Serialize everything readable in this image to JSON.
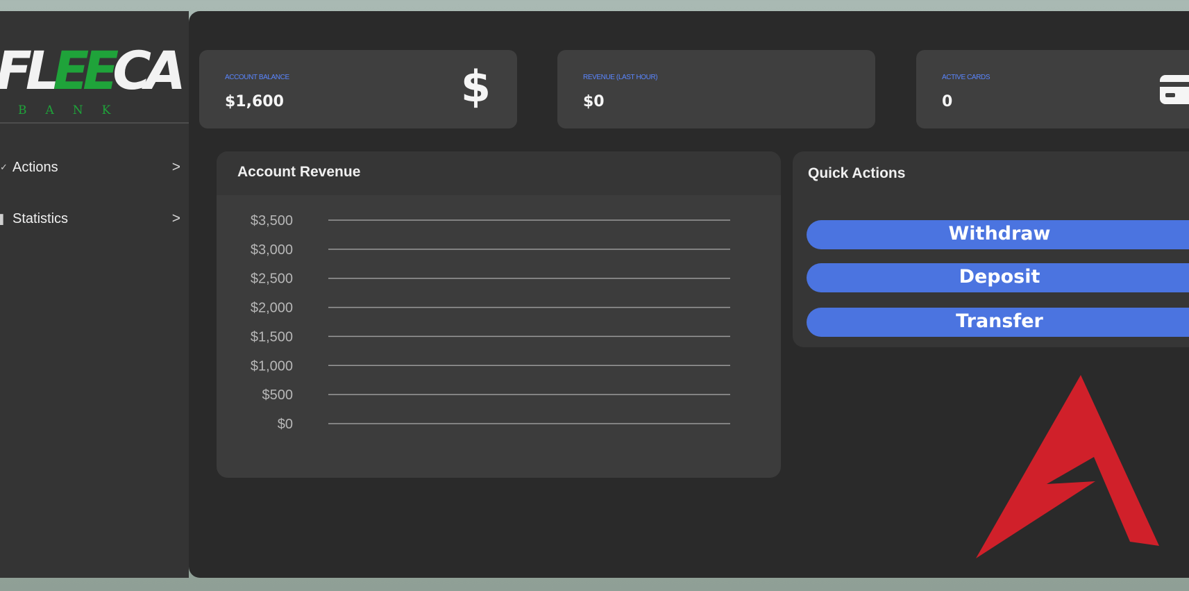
{
  "sidebar": {
    "logo_word_white_1": "FL",
    "logo_word_green": "EE",
    "logo_word_white_2": "CA",
    "logo_subtitle": "BANK",
    "items": [
      {
        "label": "Actions",
        "icon": "check-icon",
        "chevron": ">"
      },
      {
        "label": "Statistics",
        "icon": "bar-chart-icon",
        "chevron": ">"
      }
    ]
  },
  "stats": [
    {
      "label": "ACCOUNT BALANCE",
      "value": "$1,600",
      "icon": "dollar-icon",
      "glyph": "$"
    },
    {
      "label": "REVENUE (LAST HOUR)",
      "value": "$0",
      "icon": null,
      "glyph": ""
    },
    {
      "label": "ACTIVE CARDS",
      "value": "0",
      "icon": "credit-card-icon",
      "glyph": ""
    }
  ],
  "revenue_panel": {
    "title": "Account Revenue"
  },
  "quick_actions": {
    "title": "Quick Actions",
    "buttons": [
      {
        "label": "Withdraw"
      },
      {
        "label": "Deposit"
      },
      {
        "label": "Transfer"
      }
    ]
  },
  "colors": {
    "accent_blue": "#4b74e0",
    "stat_label_blue": "#5a86ff",
    "brand_green": "#1fa33a",
    "brand_red": "#d0202a"
  },
  "chart_data": {
    "type": "line",
    "title": "Account Revenue",
    "xlabel": "",
    "ylabel": "",
    "ylim": [
      0,
      3500
    ],
    "y_ticks": [
      3500,
      3000,
      2500,
      2000,
      1500,
      1000,
      500,
      0
    ],
    "y_tick_labels": [
      "$3,500",
      "$3,000",
      "$2,500",
      "$2,000",
      "$1,500",
      "$1,000",
      "$500",
      "$0"
    ],
    "grid": true,
    "series": []
  }
}
